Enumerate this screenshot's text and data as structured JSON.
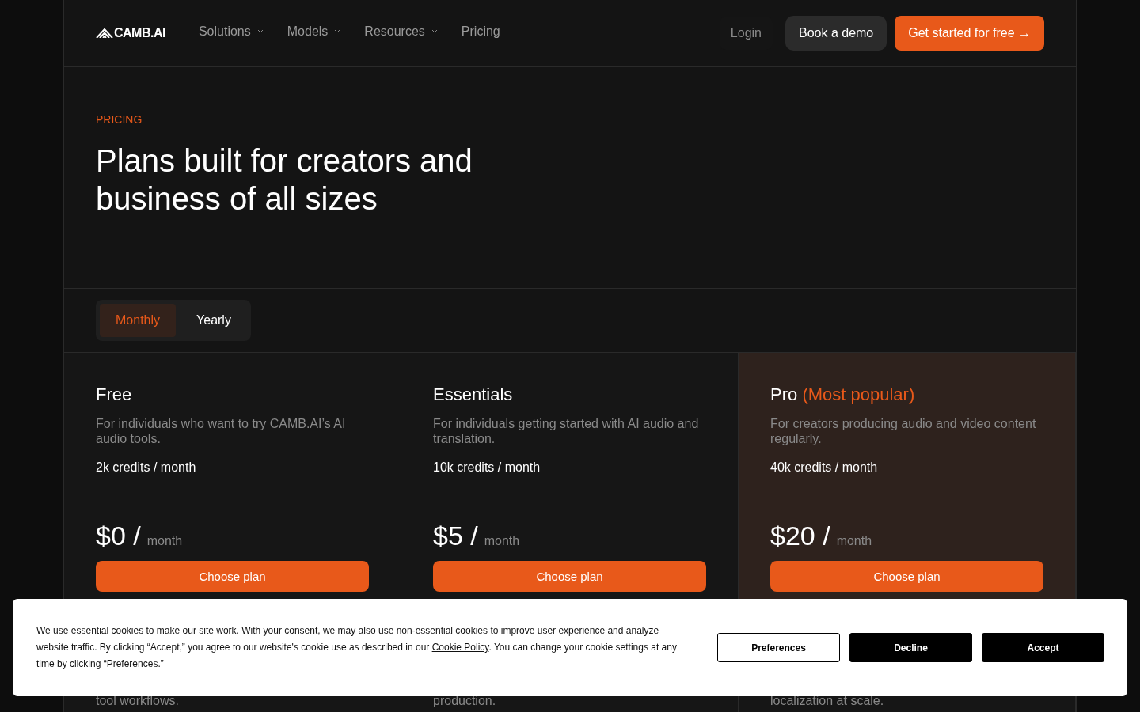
{
  "nav": {
    "logo": "CAMB.AI",
    "menu": [
      {
        "label": "Solutions",
        "dropdown": true
      },
      {
        "label": "Models",
        "dropdown": true
      },
      {
        "label": "Resources",
        "dropdown": true
      },
      {
        "label": "Pricing",
        "dropdown": false
      }
    ],
    "login": "Login",
    "demo": "Book a demo",
    "cta": "Get started for free →"
  },
  "hero": {
    "eyebrow": "PRICING",
    "title": "Plans built for creators and business of all sizes"
  },
  "billing_tabs": [
    {
      "label": "Monthly",
      "selected": true
    },
    {
      "label": "Yearly",
      "selected": false
    }
  ],
  "plans": [
    {
      "name": "Free",
      "highlighted": false,
      "description": "For individuals who want to try CAMB.AI’s AI audio tools.",
      "credits": "2k credits / month",
      "price": "$0 /",
      "period": "month",
      "button": "Choose plan"
    },
    {
      "name": "Essentials",
      "highlighted": false,
      "description": "For individuals getting started with AI audio and translation.",
      "credits": "10k credits / month",
      "price": "$5 /",
      "period": "month",
      "button": "Choose plan"
    },
    {
      "name": "Pro",
      "badge": "(Most popular)",
      "highlighted": true,
      "description": "For creators producing audio and video content regularly.",
      "credits": "40k credits / month",
      "price": "$20 /",
      "period": "month",
      "button": "Choose plan"
    }
  ],
  "next_plans": [
    {
      "description_visible": "tool workflows.",
      "highlighted": false
    },
    {
      "description_visible": "production.",
      "highlighted": false
    },
    {
      "description_visible": "localization at scale.",
      "highlighted": false
    }
  ],
  "cookie_banner": {
    "text": "We use essential cookies to make our site work. With your consent, we may also use non-essential cookies to improve user experience and analyze website traffic. By clicking “Accept,” you agree to our website's cookie use as described in our ",
    "policy_link": "Cookie Policy",
    "text_2": ". You can change your cookie settings at any time by clicking “",
    "prefs_link": "Preferences",
    "text_3": ".”",
    "buttons": [
      {
        "label": "Preferences",
        "kind": "outline"
      },
      {
        "label": "Decline",
        "kind": "solid"
      },
      {
        "label": "Accept",
        "kind": "solid"
      }
    ]
  }
}
